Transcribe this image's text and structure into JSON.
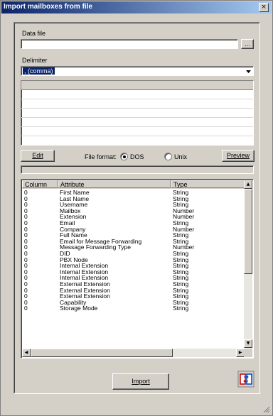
{
  "window": {
    "title": "Import mailboxes from file",
    "close_glyph": "×"
  },
  "datafile": {
    "label": "Data file",
    "value": "",
    "browse_label": "..."
  },
  "delimiter": {
    "label": "Delimiter",
    "selected": ", (comma)"
  },
  "controls": {
    "edit_label": "Edit",
    "file_format_label": "File format:",
    "dos_label": "DOS",
    "unix_label": "Unix",
    "selected_format": "DOS",
    "preview_label": "Preview"
  },
  "table": {
    "columns": [
      "Column",
      "Attribute",
      "Type"
    ],
    "rows": [
      [
        "0",
        "First Name",
        "String"
      ],
      [
        "0",
        "Last Name",
        "String"
      ],
      [
        "0",
        "Username",
        "String"
      ],
      [
        "0",
        "Mailbox",
        "Number"
      ],
      [
        "0",
        "Extension",
        "Number"
      ],
      [
        "0",
        "Email",
        "String"
      ],
      [
        "0",
        "Company",
        "Number"
      ],
      [
        "0",
        "Full Name",
        "String"
      ],
      [
        "0",
        "Email for Message Forwarding",
        "String"
      ],
      [
        "0",
        "Message Forwarding Type",
        "Number"
      ],
      [
        "0",
        "DID",
        "String"
      ],
      [
        "0",
        "PBX Node",
        "String"
      ],
      [
        "0",
        "Internal Extension",
        "String"
      ],
      [
        "0",
        "Internal Extension",
        "String"
      ],
      [
        "0",
        "Internal Extension",
        "String"
      ],
      [
        "0",
        "External Extension",
        "String"
      ],
      [
        "0",
        "External Extension",
        "String"
      ],
      [
        "0",
        "External Extension",
        "String"
      ],
      [
        "0",
        "Capability",
        "String"
      ],
      [
        "0",
        "Storage Mode",
        "String"
      ]
    ]
  },
  "import_label": "Import",
  "icons": {
    "title_close": "close-icon",
    "import_icon": "import-mailboxes-icon",
    "dropdown": "chevron-down-icon",
    "resize": "resize-grip-icon"
  }
}
